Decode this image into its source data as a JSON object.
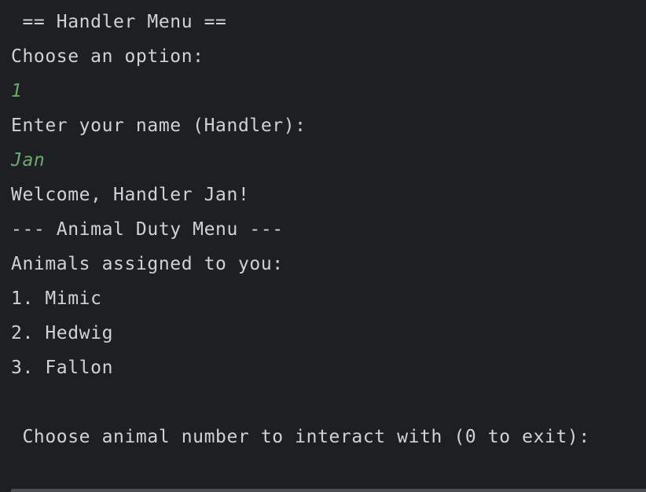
{
  "console": {
    "lines": [
      " == Handler Menu ==",
      "Choose an option:",
      "1",
      "Enter your name (Handler):",
      "Jan",
      "Welcome, Handler Jan!",
      "--- Animal Duty Menu ---",
      "Animals assigned to you:",
      "1. Mimic",
      "2. Hedwig",
      "3. Fallon",
      "",
      " Choose animal number to interact with (0 to exit):"
    ]
  },
  "colors": {
    "background": "#1e1f22",
    "text": "#cfd2d6",
    "user_input": "#6aab73"
  }
}
